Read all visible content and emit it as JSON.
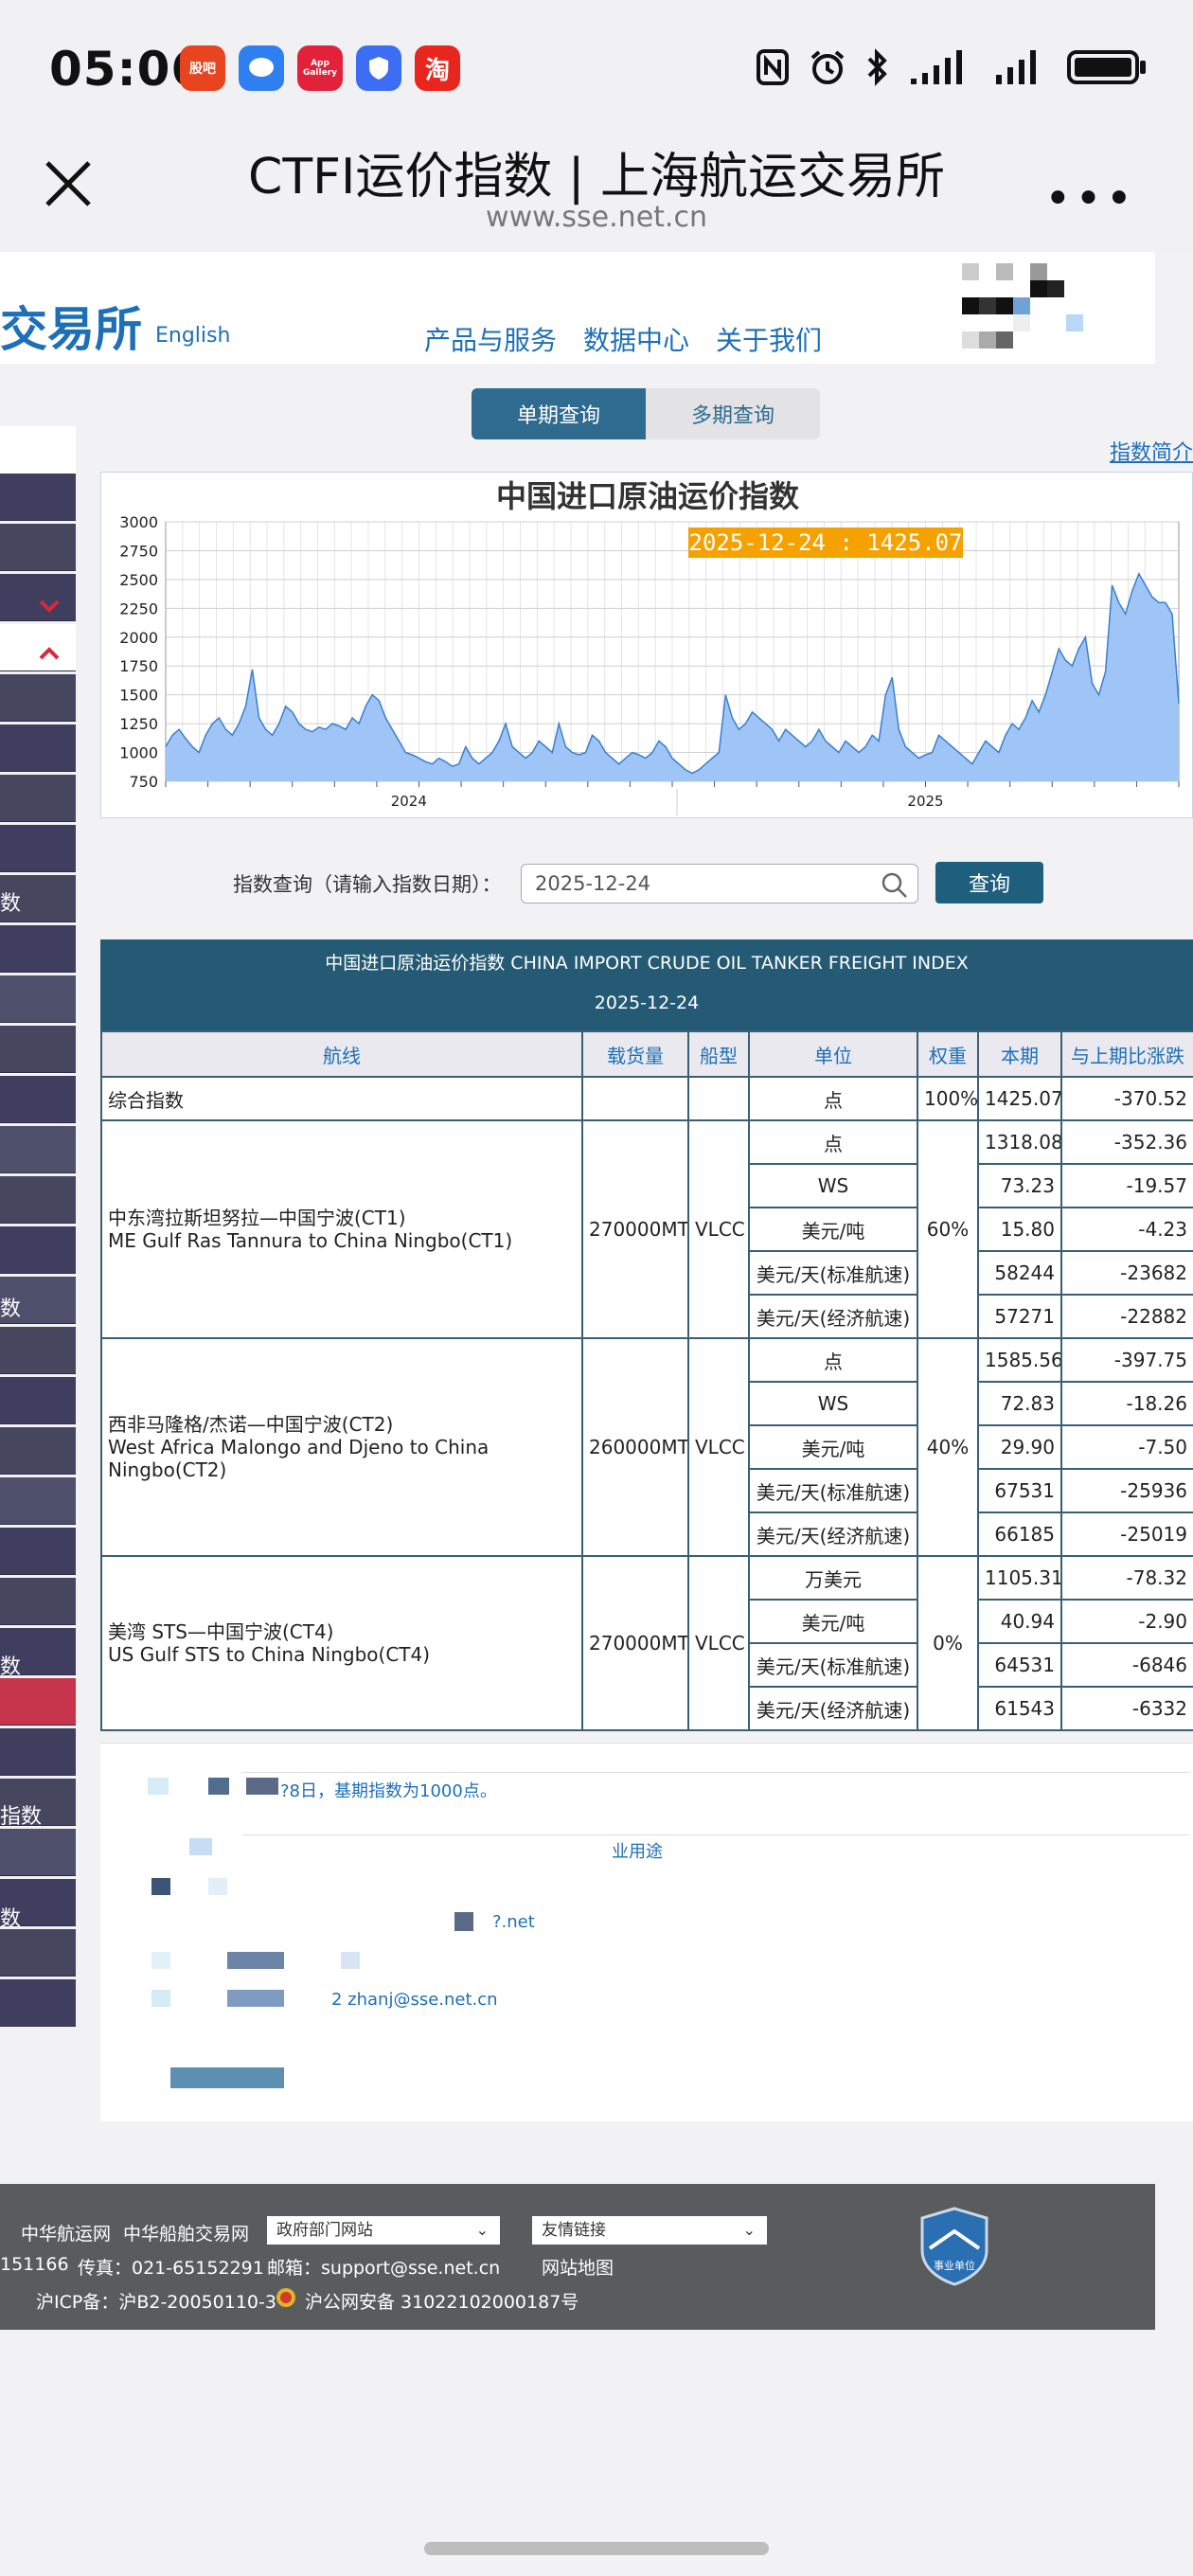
{
  "status": {
    "time": "05:06",
    "apps": [
      {
        "label": "股吧",
        "color": "#e8441f"
      },
      {
        "label": "",
        "color": "#2f7ff0"
      },
      {
        "label": "App Gallery",
        "color": "#e2223b"
      },
      {
        "label": "",
        "color": "#3b6ef5"
      },
      {
        "label": "淘",
        "color": "#e8261e"
      }
    ]
  },
  "browser": {
    "title": "CTFI运价指数 | 上海航运交易所",
    "url": "www.sse.net.cn"
  },
  "site": {
    "logo": "交易所",
    "english": "English",
    "nav": [
      "产品与服务",
      "数据中心",
      "关于我们"
    ]
  },
  "sidebar": {
    "texts": [
      "数",
      "数",
      "数",
      "指数",
      "数"
    ]
  },
  "tabs": {
    "single": "单期查询",
    "multi": "多期查询"
  },
  "index_intro": "指数简介",
  "chart_data": {
    "type": "area",
    "title": "中国进口原油运价指数",
    "tooltip": "2025-12-24 : 1425.07",
    "ylim": [
      750,
      3000
    ],
    "yticks": [
      3000,
      2750,
      2500,
      2250,
      2000,
      1750,
      1500,
      1250,
      1000,
      750
    ],
    "xticks": [
      {
        "label": "2024",
        "x": 0.24
      },
      {
        "label": "2025",
        "x": 0.75
      }
    ],
    "color": "#9ec5f5",
    "stroke": "#3a7fd0",
    "values": [
      1050,
      1150,
      1200,
      1120,
      1050,
      1000,
      1150,
      1250,
      1300,
      1200,
      1150,
      1250,
      1400,
      1720,
      1300,
      1200,
      1150,
      1250,
      1400,
      1350,
      1250,
      1200,
      1180,
      1220,
      1200,
      1250,
      1230,
      1200,
      1300,
      1250,
      1400,
      1500,
      1450,
      1300,
      1200,
      1100,
      1000,
      980,
      950,
      920,
      900,
      950,
      920,
      880,
      900,
      1050,
      950,
      900,
      950,
      1000,
      1100,
      1250,
      1050,
      1000,
      950,
      1000,
      1100,
      1050,
      1000,
      1250,
      1050,
      1000,
      980,
      1000,
      1150,
      1100,
      1000,
      950,
      900,
      950,
      1000,
      980,
      950,
      1000,
      1100,
      1050,
      950,
      900,
      850,
      820,
      850,
      900,
      950,
      1000,
      1500,
      1300,
      1200,
      1250,
      1350,
      1300,
      1250,
      1200,
      1100,
      1200,
      1150,
      1100,
      1050,
      1100,
      1200,
      1100,
      1050,
      1000,
      1100,
      1050,
      1000,
      1050,
      1150,
      1100,
      1500,
      1650,
      1200,
      1050,
      1000,
      950,
      980,
      1000,
      1150,
      1100,
      1050,
      1000,
      950,
      900,
      1000,
      1100,
      1050,
      1000,
      1150,
      1250,
      1200,
      1300,
      1450,
      1350,
      1500,
      1700,
      1900,
      1800,
      1750,
      1900,
      2000,
      1600,
      1500,
      1700,
      2450,
      2300,
      2200,
      2400,
      2550,
      2450,
      2350,
      2300,
      2300,
      2200,
      1425
    ]
  },
  "query": {
    "label": "指数查询（请输入指数日期）：",
    "date": "2025-12-24",
    "button": "查询"
  },
  "table": {
    "title": "中国进口原油运价指数 CHINA IMPORT CRUDE OIL TANKER FREIGHT INDEX",
    "date": "2025-12-24",
    "headers": [
      "航线",
      "载货量",
      "船型",
      "单位",
      "权重",
      "本期",
      "与上期比涨跌"
    ],
    "composite": {
      "name": "综合指数",
      "unit": "点",
      "weight": "100%",
      "current": "1425.07",
      "change": "-370.52"
    },
    "ct1": {
      "route_cn": "中东湾拉斯坦努拉—中国宁波(CT1)",
      "route_en": "ME Gulf Ras Tannura to China Ningbo(CT1)",
      "cargo": "270000MT",
      "ship": "VLCC",
      "weight": "60%",
      "rows": [
        {
          "unit": "点",
          "current": "1318.08",
          "change": "-352.36"
        },
        {
          "unit": "WS",
          "current": "73.23",
          "change": "-19.57"
        },
        {
          "unit": "美元/吨",
          "current": "15.80",
          "change": "-4.23"
        },
        {
          "unit": "美元/天(标准航速)",
          "current": "58244",
          "change": "-23682"
        },
        {
          "unit": "美元/天(经济航速)",
          "current": "57271",
          "change": "-22882"
        }
      ]
    },
    "ct2": {
      "route_cn": "西非马隆格/杰诺—中国宁波(CT2)",
      "route_en": "West Africa Malongo and Djeno to China Ningbo(CT2)",
      "cargo": "260000MT",
      "ship": "VLCC",
      "weight": "40%",
      "rows": [
        {
          "unit": "点",
          "current": "1585.56",
          "change": "-397.75"
        },
        {
          "unit": "WS",
          "current": "72.83",
          "change": "-18.26"
        },
        {
          "unit": "美元/吨",
          "current": "29.90",
          "change": "-7.50"
        },
        {
          "unit": "美元/天(标准航速)",
          "current": "67531",
          "change": "-25936"
        },
        {
          "unit": "美元/天(经济航速)",
          "current": "66185",
          "change": "-25019"
        }
      ]
    },
    "ct4": {
      "route_cn": "美湾 STS—中国宁波(CT4)",
      "route_en": "US Gulf STS to China Ningbo(CT4)",
      "cargo": "270000MT",
      "ship": "VLCC",
      "weight": "0%",
      "rows": [
        {
          "unit": "万美元",
          "current": "1105.31",
          "change": "-78.32"
        },
        {
          "unit": "美元/吨",
          "current": "40.94",
          "change": "-2.90"
        },
        {
          "unit": "美元/天(标准航速)",
          "current": "64531",
          "change": "-6846"
        },
        {
          "unit": "美元/天(经济航速)",
          "current": "61543",
          "change": "-6332"
        }
      ]
    }
  },
  "notes": {
    "line1": "?8日，基期指数为1000点。",
    "line2": "业用途",
    "line3": "?.net",
    "line4": "2 zhanj@sse.net.cn"
  },
  "footer": {
    "link1": "中华航运网",
    "link2": "中华船舶交易网",
    "select1": "政府部门网站",
    "select2": "友情链接",
    "phone": "151166",
    "fax": "传真：021-65152291",
    "email": "邮箱：support@sse.net.cn",
    "sitemap": "网站地图",
    "icp": "沪ICP备：沪B2-20050110-3",
    "police": "沪公网安备 31022102000187号",
    "badge": "事业单位"
  }
}
